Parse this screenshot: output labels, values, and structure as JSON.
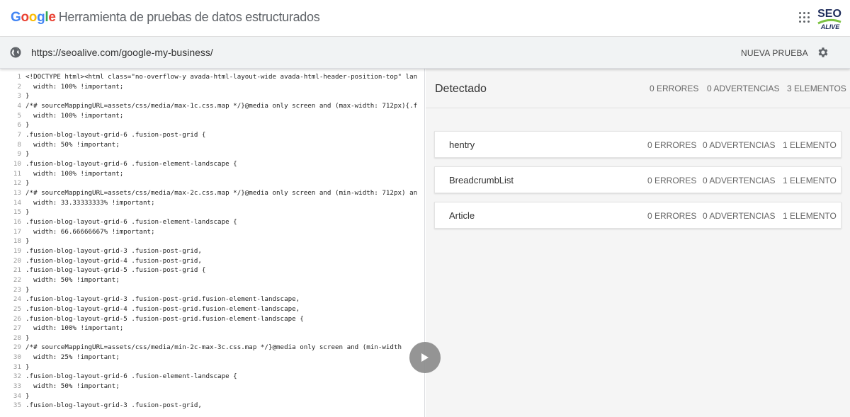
{
  "header": {
    "brand": "Google",
    "title": "Herramienta de pruebas de datos estructurados",
    "logo_text": "SEO",
    "logo_subtext": "ALIVE"
  },
  "urlbar": {
    "url": "https://seoalive.com/google-my-business/",
    "new_test_label": "NUEVA PRUEBA"
  },
  "code_lines": [
    {
      "n": "1",
      "t": "<!DOCTYPE html><html class=\"no-overflow-y avada-html-layout-wide avada-html-header-position-top\" lan"
    },
    {
      "n": "2",
      "t": "  width: 100% !important;"
    },
    {
      "n": "3",
      "t": "}"
    },
    {
      "n": "4",
      "t": "/*# sourceMappingURL=assets/css/media/max-1c.css.map */}@media only screen and (max-width: 712px){.f"
    },
    {
      "n": "5",
      "t": "  width: 100% !important;"
    },
    {
      "n": "6",
      "t": "}"
    },
    {
      "n": "7",
      "t": ".fusion-blog-layout-grid-6 .fusion-post-grid {"
    },
    {
      "n": "8",
      "t": "  width: 50% !important;"
    },
    {
      "n": "9",
      "t": "}"
    },
    {
      "n": "10",
      "t": ".fusion-blog-layout-grid-6 .fusion-element-landscape {"
    },
    {
      "n": "11",
      "t": "  width: 100% !important;"
    },
    {
      "n": "12",
      "t": "}"
    },
    {
      "n": "13",
      "t": "/*# sourceMappingURL=assets/css/media/max-2c.css.map */}@media only screen and (min-width: 712px) an"
    },
    {
      "n": "14",
      "t": "  width: 33.33333333% !important;"
    },
    {
      "n": "15",
      "t": "}"
    },
    {
      "n": "16",
      "t": ".fusion-blog-layout-grid-6 .fusion-element-landscape {"
    },
    {
      "n": "17",
      "t": "  width: 66.66666667% !important;"
    },
    {
      "n": "18",
      "t": "}"
    },
    {
      "n": "19",
      "t": ".fusion-blog-layout-grid-3 .fusion-post-grid,"
    },
    {
      "n": "20",
      "t": ".fusion-blog-layout-grid-4 .fusion-post-grid,"
    },
    {
      "n": "21",
      "t": ".fusion-blog-layout-grid-5 .fusion-post-grid {"
    },
    {
      "n": "22",
      "t": "  width: 50% !important;"
    },
    {
      "n": "23",
      "t": "}"
    },
    {
      "n": "24",
      "t": ".fusion-blog-layout-grid-3 .fusion-post-grid.fusion-element-landscape,"
    },
    {
      "n": "25",
      "t": ".fusion-blog-layout-grid-4 .fusion-post-grid.fusion-element-landscape,"
    },
    {
      "n": "26",
      "t": ".fusion-blog-layout-grid-5 .fusion-post-grid.fusion-element-landscape {"
    },
    {
      "n": "27",
      "t": "  width: 100% !important;"
    },
    {
      "n": "28",
      "t": "}"
    },
    {
      "n": "29",
      "t": "/*# sourceMappingURL=assets/css/media/min-2c-max-3c.css.map */}@media only screen and (min-width"
    },
    {
      "n": "30",
      "t": "  width: 25% !important;"
    },
    {
      "n": "31",
      "t": "}"
    },
    {
      "n": "32",
      "t": ".fusion-blog-layout-grid-6 .fusion-element-landscape {"
    },
    {
      "n": "33",
      "t": "  width: 50% !important;"
    },
    {
      "n": "34",
      "t": "}"
    },
    {
      "n": "35",
      "t": ".fusion-blog-layout-grid-3 .fusion-post-grid,"
    }
  ],
  "results": {
    "title": "Detectado",
    "errors": "0 ERRORES",
    "warnings": "0 ADVERTENCIAS",
    "items": "3 ELEMENTOS",
    "cards": [
      {
        "name": "hentry",
        "errors": "0 ERRORES",
        "warnings": "0 ADVERTENCIAS",
        "items": "1 ELEMENTO"
      },
      {
        "name": "BreadcrumbList",
        "errors": "0 ERRORES",
        "warnings": "0 ADVERTENCIAS",
        "items": "1 ELEMENTO"
      },
      {
        "name": "Article",
        "errors": "0 ERRORES",
        "warnings": "0 ADVERTENCIAS",
        "items": "1 ELEMENTO"
      }
    ]
  },
  "colors": {
    "google_blue": "#4285f4",
    "google_red": "#ea4335",
    "google_yellow": "#fbbc05",
    "google_green": "#34a853",
    "seo_navy": "#1d2b5a",
    "seo_green": "#7cc242"
  },
  "icons": [
    "apps-grid-icon",
    "globe-icon",
    "gear-icon",
    "play-icon"
  ]
}
